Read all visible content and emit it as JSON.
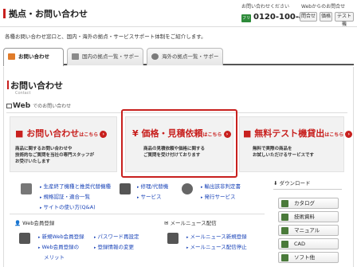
{
  "header": {
    "title": "拠点・お問い合わせ",
    "phone_label": "お問い合わせください",
    "web_label": "Webからのお問合せ",
    "phone_icon": "フリー",
    "phone": "0120-100-470",
    "buttons": [
      "問合せ",
      "価格",
      "テスト機"
    ]
  },
  "intro": "各種お問い合わせ窓口と、国内・海外の拠点・サービスサポート体制をご紹介します。",
  "tabs": [
    {
      "label": "お問い合わせ",
      "active": true
    },
    {
      "label": "国内の拠点一覧・サポート",
      "active": false
    },
    {
      "label": "海外の拠点一覧・サポート",
      "active": false
    }
  ],
  "section": {
    "title": "お問い合わせ",
    "subtitle": "Contact"
  },
  "web": {
    "label": "Web",
    "sub": "でのお問い合わせ"
  },
  "cards": [
    {
      "head": "お問い合わせ",
      "suffix": "はこちら",
      "body": [
        "商品に関するお問い合わせや",
        "技術的なご質問を当社の専門スタッフが",
        "お受けいたします"
      ]
    },
    {
      "head": "価格・見積依頼",
      "suffix": "はこちら",
      "body": [
        "商品の見積依頼や価格に関する",
        "ご質問を受け付けております"
      ]
    },
    {
      "head": "無料テスト機貸出",
      "suffix": "はこちら",
      "body": [
        "無料で実際の商品を",
        "お試しいただけるサービスです"
      ]
    }
  ],
  "services": [
    {
      "links": [
        "生産終了機種と推奨代替機種",
        "規格認証・適合一覧",
        "サイトの使い方(Q&A)"
      ]
    },
    {
      "links": [
        "修理/代替機",
        "サービス"
      ]
    },
    {
      "links": [
        "輸出該非判定書",
        "発行サービス"
      ]
    }
  ],
  "member": {
    "title": "Web会員登録",
    "links": [
      "新規Web会員登録",
      "Web会員登録の",
      "メリット",
      "パスワード再設定",
      "登録情報の変更"
    ]
  },
  "news": {
    "title": "メールニュース配信",
    "links": [
      "メールニュース新規登録",
      "メールニュース配信停止"
    ]
  },
  "download": {
    "title": "ダウンロード",
    "items": [
      "カタログ",
      "技術資料",
      "マニュアル",
      "CAD",
      "ソフト他"
    ]
  },
  "colors": {
    "accent": "#c8201e",
    "link": "#1a44b8"
  }
}
